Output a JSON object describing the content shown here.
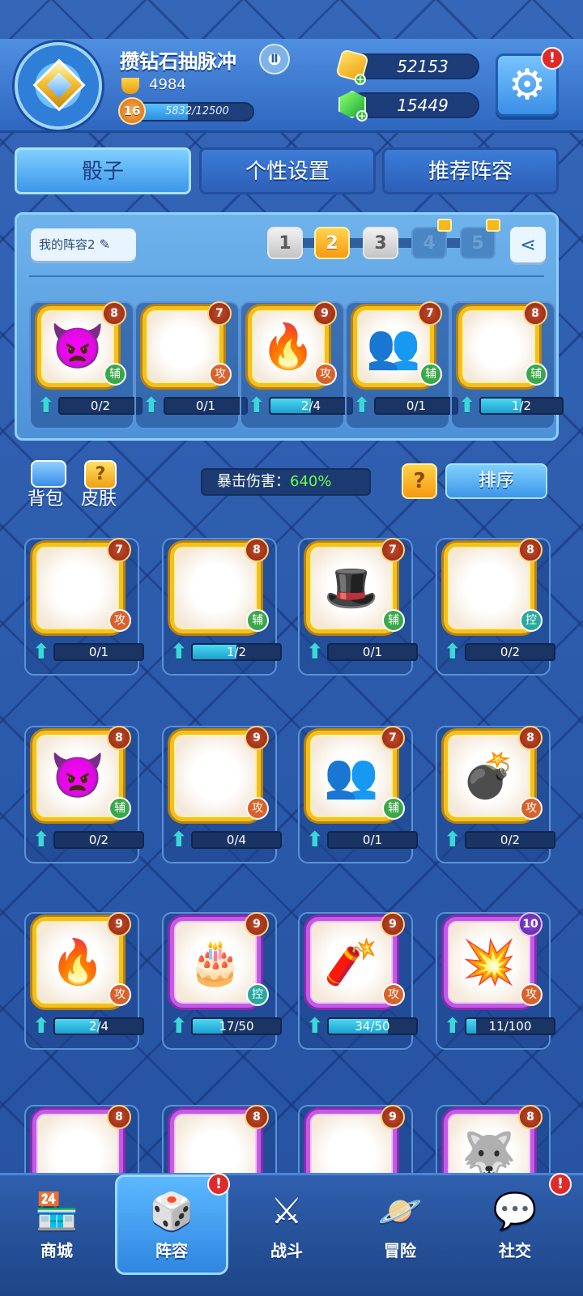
{
  "header": {
    "player_name": "攒钻石抽脉冲",
    "rank_badge": "Ⅱ",
    "trophies": "4984",
    "level": "16",
    "xp_text": "5832/12500",
    "xp_fraction": 0.466,
    "coins": "52153",
    "gems": "15449",
    "alert": "!"
  },
  "tabs": [
    "骰子",
    "个性设置",
    "推荐阵容"
  ],
  "lineup": {
    "name": "我的阵容2",
    "slots": [
      "1",
      "2",
      "3",
      "4",
      "5"
    ],
    "selected_slot": "2",
    "locked_slots": [
      "4",
      "5"
    ],
    "dice": [
      {
        "icon": "demon-icon",
        "level": "8",
        "role": "辅",
        "progress": "0/2",
        "fraction": 0
      },
      {
        "icon": "purple-slash-icon",
        "level": "7",
        "role": "攻",
        "progress": "0/1",
        "fraction": 0
      },
      {
        "icon": "claw-icon",
        "level": "9",
        "role": "攻",
        "progress": "2/4",
        "fraction": 0.5
      },
      {
        "icon": "silhouette-icon",
        "level": "7",
        "role": "辅",
        "progress": "0/1",
        "fraction": 0
      },
      {
        "icon": "hex-rune-icon",
        "level": "8",
        "role": "辅",
        "progress": "1/2",
        "fraction": 0.5
      }
    ]
  },
  "toolbar": {
    "bag_label": "背包",
    "skin_label": "皮肤",
    "skin_icon_glyph": "?",
    "crit_label": "暴击伤害：",
    "crit_value": "640%",
    "help_glyph": "?",
    "sort_label": "排序"
  },
  "collection": [
    {
      "icon": "sun-icon",
      "glyph": "☀",
      "level": "7",
      "role": "攻",
      "progress": "0/1",
      "fraction": 0,
      "frame": "gold"
    },
    {
      "icon": "hex-rune-icon",
      "glyph": "✡",
      "level": "8",
      "role": "辅",
      "progress": "1/2",
      "fraction": 0.5,
      "frame": "gold"
    },
    {
      "icon": "red-hat-icon",
      "glyph": "🎩",
      "level": "7",
      "role": "辅",
      "progress": "0/1",
      "fraction": 0,
      "frame": "gold"
    },
    {
      "icon": "snowflake-icon",
      "glyph": "❄",
      "level": "8",
      "role": "控",
      "progress": "0/2",
      "fraction": 0,
      "frame": "gold"
    },
    {
      "icon": "demon-icon",
      "glyph": "👿",
      "level": "8",
      "role": "辅",
      "progress": "0/2",
      "fraction": 0,
      "frame": "gold"
    },
    {
      "icon": "ice-spirit-icon",
      "glyph": "❈",
      "level": "9",
      "role": "攻",
      "progress": "0/4",
      "fraction": 0,
      "frame": "gold"
    },
    {
      "icon": "silhouette-icon",
      "glyph": "👥",
      "level": "7",
      "role": "辅",
      "progress": "0/1",
      "fraction": 0,
      "frame": "gold"
    },
    {
      "icon": "bomb-icon",
      "glyph": "💣",
      "level": "8",
      "role": "攻",
      "progress": "0/2",
      "fraction": 0,
      "frame": "gold"
    },
    {
      "icon": "claw-icon",
      "glyph": "🔥",
      "level": "9",
      "role": "攻",
      "progress": "2/4",
      "fraction": 0.5,
      "frame": "gold"
    },
    {
      "icon": "cake-icon",
      "glyph": "🎂",
      "level": "9",
      "role": "控",
      "progress": "17/50",
      "fraction": 0.34,
      "frame": "purple"
    },
    {
      "icon": "firecracker-icon",
      "glyph": "🧨",
      "level": "9",
      "role": "攻",
      "progress": "34/50",
      "fraction": 0.68,
      "frame": "purple"
    },
    {
      "icon": "explosion-icon",
      "glyph": "💥",
      "level": "10",
      "role": "攻",
      "progress": "11/100",
      "fraction": 0.11,
      "frame": "purple"
    },
    {
      "icon": "blood-circle-icon",
      "glyph": "◉",
      "level": "8",
      "role": "",
      "progress": "",
      "fraction": 0,
      "frame": "purple"
    },
    {
      "icon": "sharingan-icon",
      "glyph": "◎",
      "level": "8",
      "role": "",
      "progress": "",
      "fraction": 0,
      "frame": "purple"
    },
    {
      "icon": "golden-seal-icon",
      "glyph": "✺",
      "level": "9",
      "role": "",
      "progress": "",
      "fraction": 0,
      "frame": "purple"
    },
    {
      "icon": "wolf-moon-icon",
      "glyph": "🐺",
      "level": "8",
      "role": "",
      "progress": "",
      "fraction": 0,
      "frame": "purple"
    }
  ],
  "nav": [
    {
      "label": "商城",
      "icon": "shop-icon",
      "glyph": "🏪"
    },
    {
      "label": "阵容",
      "icon": "dice-icon",
      "glyph": "🎲"
    },
    {
      "label": "战斗",
      "icon": "swords-icon",
      "glyph": "⚔"
    },
    {
      "label": "冒险",
      "icon": "planet-icon",
      "glyph": "🪐"
    },
    {
      "label": "社交",
      "icon": "chat-icon",
      "glyph": "💬"
    }
  ],
  "colors": {
    "accent": "#3d96e8",
    "gold_frame": "#f4c01e",
    "purple_frame": "#c45be6",
    "crit_green": "#6aff4a"
  }
}
